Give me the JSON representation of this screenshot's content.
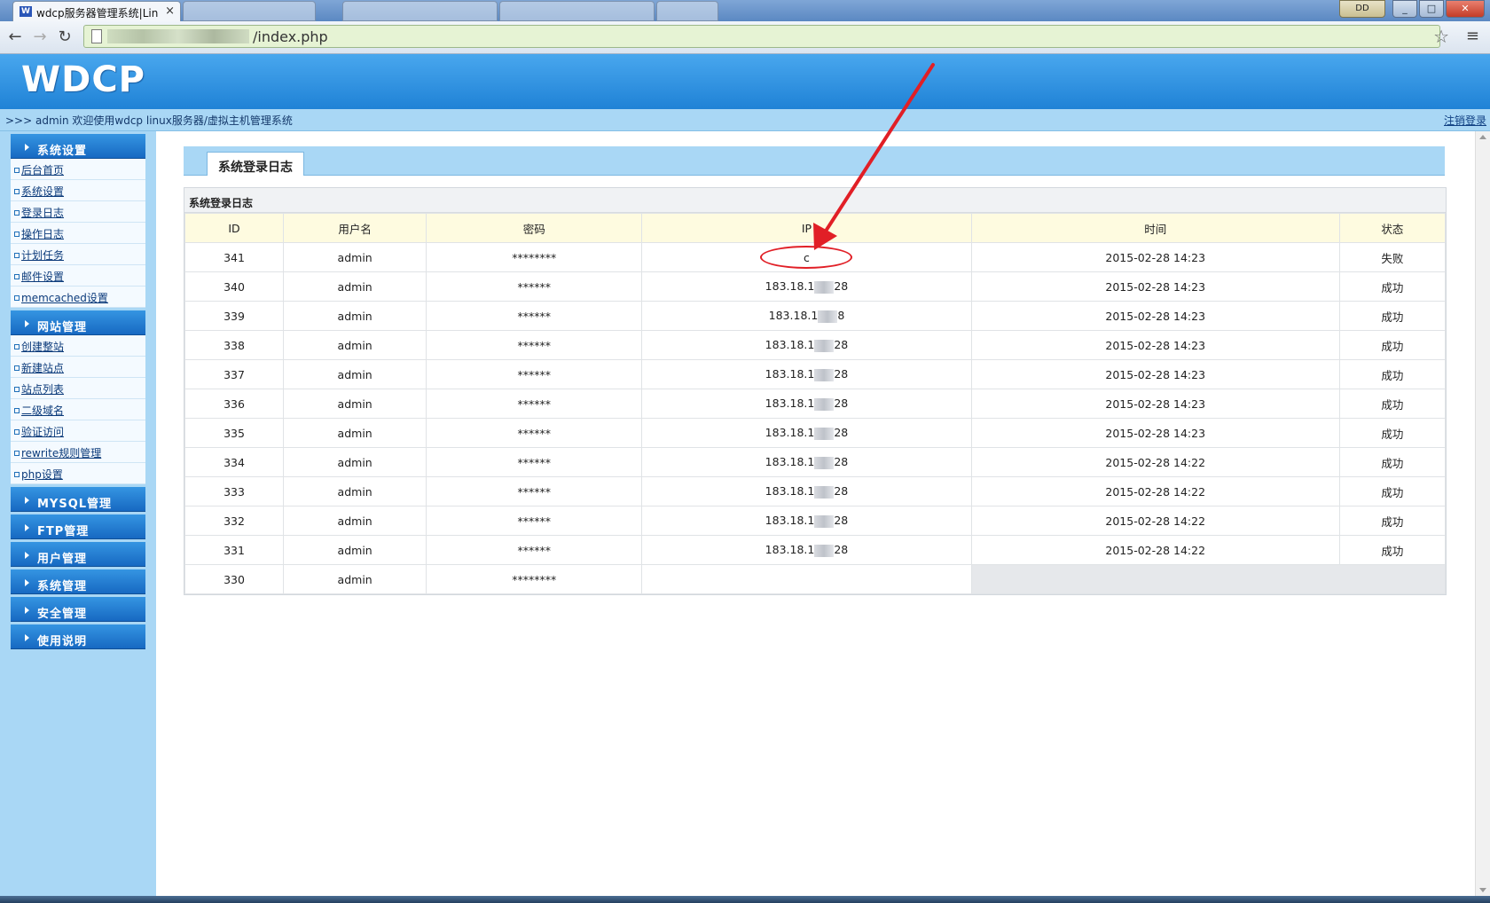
{
  "browser": {
    "tab_title": "wdcp服务器管理系统|Lin",
    "tab_close": "×",
    "favicon": "W",
    "url_path": "/index.php",
    "user_badge": "DD",
    "win_min": "_",
    "win_max": "□",
    "win_close": "✕",
    "back": "←",
    "forward": "→",
    "reload": "↻",
    "star": "☆",
    "menu": "≡"
  },
  "header": {
    "logo": "WDCP",
    "welcome": ">>> admin 欢迎使用wdcp linux服务器/虚拟主机管理系统",
    "logout": "注销登录"
  },
  "sidebar": {
    "sections": [
      {
        "label": "系统设置",
        "items": [
          "后台首页",
          "系统设置",
          "登录日志",
          "操作日志",
          "计划任务",
          "邮件设置",
          "memcached设置"
        ]
      },
      {
        "label": "网站管理",
        "items": [
          "创建整站",
          "新建站点",
          "站点列表",
          "二级域名",
          "验证访问",
          "rewrite规则管理",
          "php设置"
        ]
      },
      {
        "label": "MYSQL管理",
        "items": []
      },
      {
        "label": "FTP管理",
        "items": []
      },
      {
        "label": "用户管理",
        "items": []
      },
      {
        "label": "系统管理",
        "items": []
      },
      {
        "label": "安全管理",
        "items": []
      },
      {
        "label": "使用说明",
        "items": []
      }
    ]
  },
  "main": {
    "tab_label": "系统登录日志",
    "panel_caption": "系统登录日志",
    "columns": [
      "ID",
      "用户名",
      "密码",
      "IP",
      "时间",
      "状态"
    ],
    "rows": [
      {
        "id": "341",
        "user": "admin",
        "password": "********",
        "ip": "c",
        "time": "2015-02-28 14:23",
        "status": "失败",
        "highlight": true
      },
      {
        "id": "340",
        "user": "admin",
        "password": "******",
        "ip_prefix": "183.18.1",
        "ip_suffix": "28",
        "time": "2015-02-28 14:23",
        "status": "成功"
      },
      {
        "id": "339",
        "user": "admin",
        "password": "******",
        "ip_prefix": "183.18.1",
        "ip_suffix": "8",
        "time": "2015-02-28 14:23",
        "status": "成功"
      },
      {
        "id": "338",
        "user": "admin",
        "password": "******",
        "ip_prefix": "183.18.1",
        "ip_suffix": "28",
        "time": "2015-02-28 14:23",
        "status": "成功"
      },
      {
        "id": "337",
        "user": "admin",
        "password": "******",
        "ip_prefix": "183.18.1",
        "ip_suffix": "28",
        "time": "2015-02-28 14:23",
        "status": "成功"
      },
      {
        "id": "336",
        "user": "admin",
        "password": "******",
        "ip_prefix": "183.18.1",
        "ip_suffix": "28",
        "time": "2015-02-28 14:23",
        "status": "成功"
      },
      {
        "id": "335",
        "user": "admin",
        "password": "******",
        "ip_prefix": "183.18.1",
        "ip_suffix": "28",
        "time": "2015-02-28 14:23",
        "status": "成功"
      },
      {
        "id": "334",
        "user": "admin",
        "password": "******",
        "ip_prefix": "183.18.1",
        "ip_suffix": "28",
        "time": "2015-02-28 14:22",
        "status": "成功"
      },
      {
        "id": "333",
        "user": "admin",
        "password": "******",
        "ip_prefix": "183.18.1",
        "ip_suffix": "28",
        "time": "2015-02-28 14:22",
        "status": "成功"
      },
      {
        "id": "332",
        "user": "admin",
        "password": "******",
        "ip_prefix": "183.18.1",
        "ip_suffix": "28",
        "time": "2015-02-28 14:22",
        "status": "成功"
      },
      {
        "id": "331",
        "user": "admin",
        "password": "******",
        "ip_prefix": "183.18.1",
        "ip_suffix": "28",
        "time": "2015-02-28 14:22",
        "status": "成功"
      },
      {
        "id": "330",
        "user": "admin",
        "password": "********",
        "ip": "",
        "time": "",
        "status": "",
        "partial": true
      }
    ]
  },
  "colors": {
    "annotation": "#e11f26",
    "header_blue": "#1f82d6",
    "sidebar_bg": "#a9d7f5"
  }
}
